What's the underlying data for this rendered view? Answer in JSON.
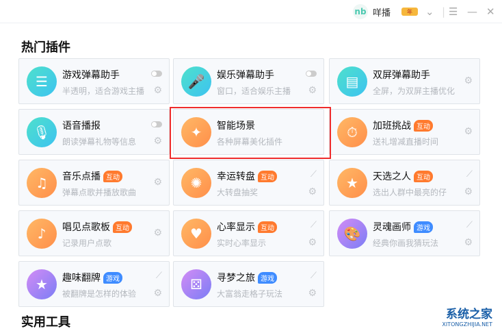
{
  "header": {
    "app_name": "咩播",
    "logo": "nb",
    "vip_label": "年",
    "icons": [
      "chevron-down-icon",
      "menu-icon",
      "minimize-icon",
      "close-icon"
    ]
  },
  "sections": {
    "hot": "热门插件",
    "tools": "实用工具"
  },
  "plugins": [
    {
      "name": "游戏弹幕助手",
      "desc": "半透明，适合游戏主播",
      "color": "teal",
      "icon": "☰",
      "badge": null,
      "toggle": true,
      "chart": false
    },
    {
      "name": "娱乐弹幕助手",
      "desc": "窗口，适合娱乐主播",
      "color": "teal",
      "icon": "🎤",
      "badge": null,
      "toggle": true,
      "chart": false
    },
    {
      "name": "双屏弹幕助手",
      "desc": "全屏，为双屏主播优化",
      "color": "teal",
      "icon": "▤",
      "badge": null,
      "toggle": false,
      "chart": false
    },
    {
      "name": "语音播报",
      "desc": "朗读弹幕礼物等信息",
      "color": "teal",
      "icon": "🎙",
      "badge": null,
      "toggle": true,
      "chart": false
    },
    {
      "name": "智能场景",
      "desc": "各种屏幕美化插件",
      "color": "orange",
      "icon": "✦",
      "badge": null,
      "toggle": false,
      "chart": false,
      "nogear": true
    },
    {
      "name": "加班挑战",
      "desc": "送礼增减直播时间",
      "color": "orange",
      "icon": "⏱",
      "badge": "互动",
      "toggle": false,
      "chart": false
    },
    {
      "name": "音乐点播",
      "desc": "弹幕点歌并播放歌曲",
      "color": "orange",
      "icon": "♫",
      "badge": "互动",
      "toggle": false,
      "chart": false
    },
    {
      "name": "幸运转盘",
      "desc": "大转盘抽奖",
      "color": "orange",
      "icon": "✺",
      "badge": "互动",
      "toggle": false,
      "chart": true
    },
    {
      "name": "天选之人",
      "desc": "选出人群中最亮的仔",
      "color": "orange",
      "icon": "★",
      "badge": "互动",
      "toggle": false,
      "chart": true
    },
    {
      "name": "唱见点歌板",
      "desc": "记录用户点歌",
      "color": "orange",
      "icon": "♪",
      "badge": "互动",
      "toggle": false,
      "chart": false
    },
    {
      "name": "心率显示",
      "desc": "实时心率显示",
      "color": "orange",
      "icon": "♥",
      "badge": "互动",
      "toggle": false,
      "chart": true
    },
    {
      "name": "灵魂画师",
      "desc": "经典你画我猜玩法",
      "color": "purple",
      "icon": "🎨",
      "badge": "游戏",
      "toggle": false,
      "chart": true
    },
    {
      "name": "趣味翻牌",
      "desc": "被翻牌是怎样的体验",
      "color": "purple",
      "icon": "★",
      "badge": "游戏",
      "toggle": false,
      "chart": true
    },
    {
      "name": "寻梦之旅",
      "desc": "大富翁走格子玩法",
      "color": "purple",
      "icon": "⚄",
      "badge": "游戏",
      "toggle": false,
      "chart": true
    }
  ],
  "watermark": {
    "title": "系统之家",
    "url": "XITONGZHIJIA.NET"
  }
}
